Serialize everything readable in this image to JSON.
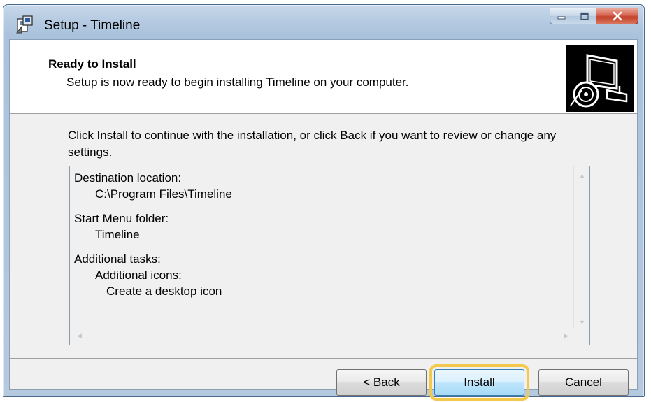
{
  "window": {
    "title": "Setup - Timeline",
    "controls": [
      "minimize",
      "maximize",
      "close"
    ]
  },
  "header": {
    "title": "Ready to Install",
    "subtitle": "Setup is now ready to begin installing Timeline on your computer.",
    "image_icon": "setup-computer-icon"
  },
  "intro_text": "Click Install to continue with the installation, or click Back if you want to review or change any settings.",
  "summary": {
    "destination_label": "Destination location:",
    "destination_value": "C:\\Program Files\\Timeline",
    "start_menu_label": "Start Menu folder:",
    "start_menu_value": "Timeline",
    "tasks_label": "Additional tasks:",
    "tasks_group": "Additional icons:",
    "tasks_item": "Create a desktop icon"
  },
  "buttons": {
    "back": "< Back",
    "install": "Install",
    "cancel": "Cancel"
  },
  "highlight_color": "#f2c94c"
}
